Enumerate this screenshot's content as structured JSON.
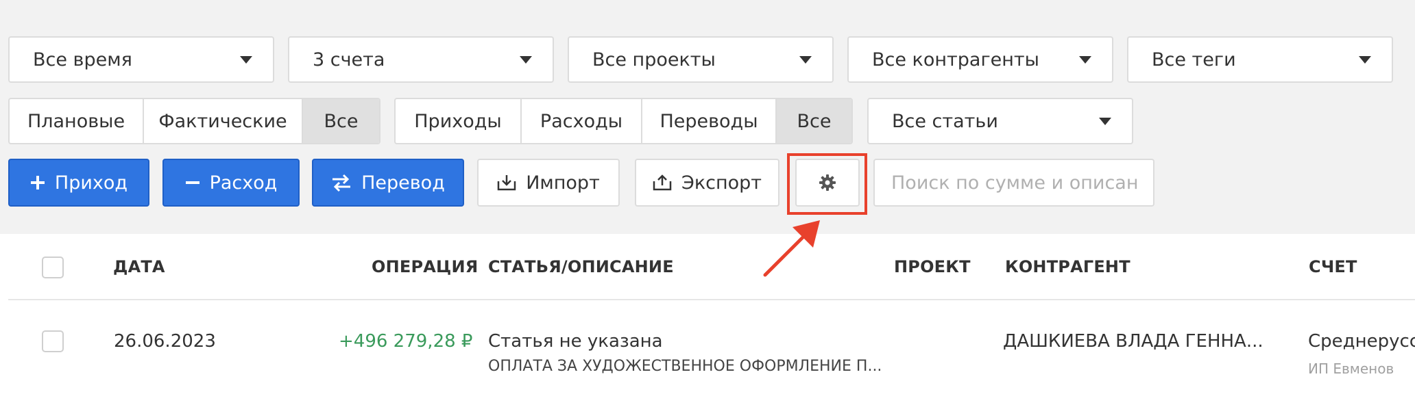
{
  "filters": {
    "period": "Все время",
    "accounts": "3 счета",
    "projects": "Все проекты",
    "contractors": "Все контрагенты",
    "tags": "Все теги",
    "articles": "Все статьи"
  },
  "type_segment": [
    "Плановые",
    "Фактические",
    "Все"
  ],
  "type_segment_active": 2,
  "direction_segment": [
    "Приходы",
    "Расходы",
    "Переводы",
    "Все"
  ],
  "direction_segment_active": 3,
  "actions": {
    "income": "Приход",
    "expense": "Расход",
    "transfer": "Перевод",
    "import": "Импорт",
    "export": "Экспорт"
  },
  "search": {
    "placeholder": "Поиск по сумме и описанию"
  },
  "table": {
    "headers": {
      "date": "ДАТА",
      "operation": "ОПЕРАЦИЯ",
      "article": "СТАТЬЯ/ОПИСАНИЕ",
      "project": "ПРОЕКТ",
      "contractor": "КОНТРАГЕНТ",
      "account": "СЧЕТ"
    },
    "rows": [
      {
        "date": "26.06.2023",
        "amount": "+496 279,28 ₽",
        "article": "Статья не указана",
        "description": "ОПЛАТА ЗА ХУДОЖЕСТВЕННОЕ ОФОРМЛЕНИЕ П...",
        "project": "",
        "contractor": "ДАШКИЕВА ВЛАДА ГЕННА...",
        "account": "Среднерусск",
        "account_sub": "ИП Евменов"
      }
    ]
  },
  "colors": {
    "accent_blue": "#2f75e1",
    "income_green": "#3a9a5b",
    "highlight_red": "#e8412c"
  },
  "icons": {
    "income": "plus-icon",
    "expense": "minus-icon",
    "transfer": "swap-arrows-icon",
    "import": "import-tray-icon",
    "export": "export-tray-icon",
    "settings": "gear-icon",
    "dropdown": "caret-down-icon"
  }
}
